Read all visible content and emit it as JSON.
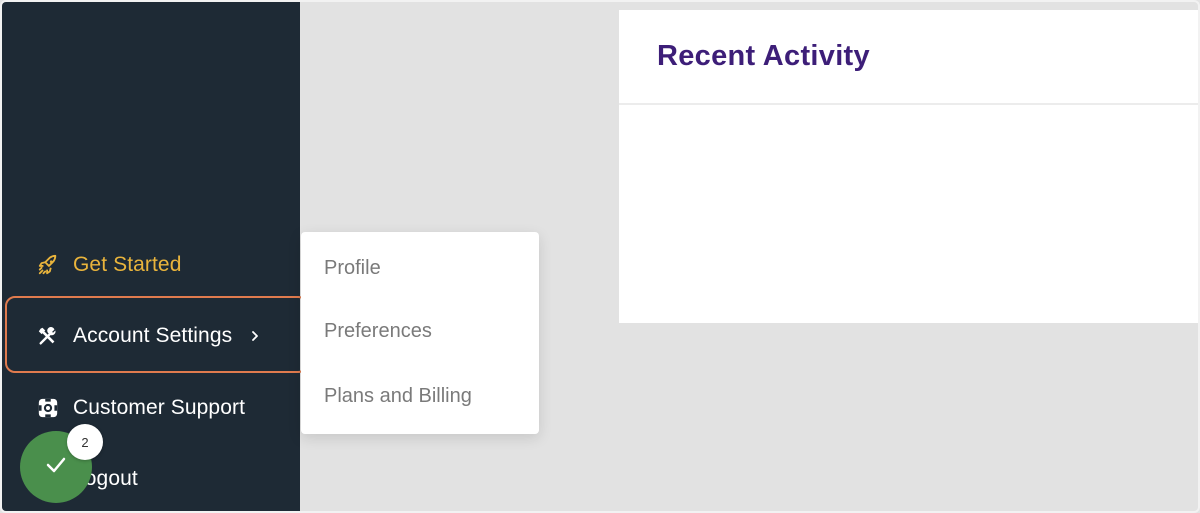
{
  "sidebar": {
    "items": [
      {
        "label": "Get Started",
        "icon": "rocket-icon",
        "color": "#e9b43c"
      },
      {
        "label": "Account Settings",
        "icon": "tools-icon",
        "chevron": ">"
      },
      {
        "label": "Customer Support",
        "icon": "lifebuoy-icon"
      },
      {
        "label": "Logout",
        "icon": "logout-icon"
      }
    ]
  },
  "submenu": {
    "items": [
      {
        "label": "Profile"
      },
      {
        "label": "Preferences"
      },
      {
        "label": "Plans and Billing"
      }
    ]
  },
  "card": {
    "title": "Recent Activity"
  },
  "fab": {
    "icon": "check-icon",
    "badge_count": "2",
    "color": "#4a8f4c"
  },
  "colors": {
    "sidebar_bg": "#1e2a35",
    "highlight_border": "#e07b4e",
    "title": "#3d1e78",
    "accent": "#e9b43c"
  }
}
